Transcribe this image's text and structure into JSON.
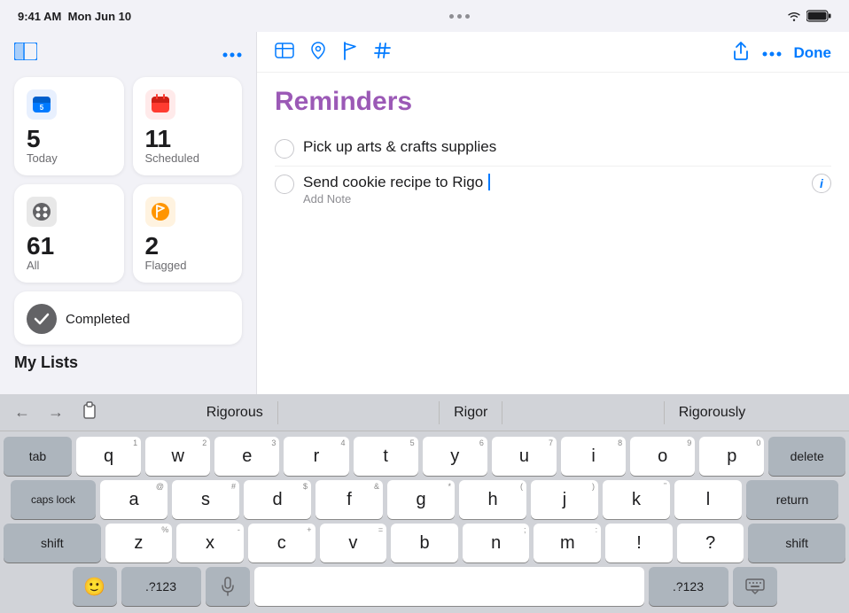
{
  "statusBar": {
    "time": "9:41 AM",
    "date": "Mon Jun 10",
    "dotsCount": 3,
    "wifi": "WiFi",
    "battery": "100%"
  },
  "sidebar": {
    "moreButtonLabel": "...",
    "cards": [
      {
        "id": "today",
        "label": "Today",
        "count": "5",
        "color": "#007aff",
        "icon": "calendar"
      },
      {
        "id": "scheduled",
        "label": "Scheduled",
        "count": "11",
        "color": "#ff3b30",
        "icon": "calendar-clock"
      },
      {
        "id": "all",
        "label": "All",
        "count": "61",
        "color": "#1c1c1e",
        "icon": "circle-grid"
      },
      {
        "id": "flagged",
        "label": "Flagged",
        "count": "2",
        "color": "#ff9500",
        "icon": "flag"
      }
    ],
    "completed": {
      "label": "Completed",
      "icon": "checkmark"
    },
    "myListsLabel": "My Lists"
  },
  "toolbar": {
    "icons": [
      "table",
      "location",
      "flag",
      "hashtag"
    ],
    "shareLabel": "share",
    "moreLabel": "more",
    "doneLabel": "Done"
  },
  "content": {
    "title": "Reminders",
    "reminders": [
      {
        "id": 1,
        "text": "Pick up arts & crafts supplies",
        "done": false
      },
      {
        "id": 2,
        "text": "Send cookie recipe to Rigo",
        "done": false,
        "editing": true
      }
    ],
    "addNotePlaceholder": "Add Note"
  },
  "keyboard": {
    "autocorrect": {
      "suggestions": [
        "Rigorous",
        "Rigor",
        "Rigorously"
      ]
    },
    "rows": [
      [
        "q",
        "w",
        "e",
        "r",
        "t",
        "y",
        "u",
        "i",
        "o",
        "p"
      ],
      [
        "a",
        "s",
        "d",
        "f",
        "g",
        "h",
        "j",
        "k",
        "l"
      ],
      [
        "z",
        "x",
        "c",
        "v",
        "b",
        "n",
        "m"
      ]
    ],
    "numbers": [
      [
        "1",
        "2",
        "3",
        "4",
        "5",
        "6",
        "7",
        "8",
        "9",
        "0"
      ]
    ],
    "specialKeys": {
      "tab": "tab",
      "capsLock": "caps lock",
      "shift": "shift",
      "delete": "delete",
      "return": "return",
      "emoji": "🙂",
      "numbers1": ".?123",
      "numbers2": ".?123",
      "microphone": "mic",
      "space": " ",
      "hideKeyboard": "⌨"
    }
  }
}
